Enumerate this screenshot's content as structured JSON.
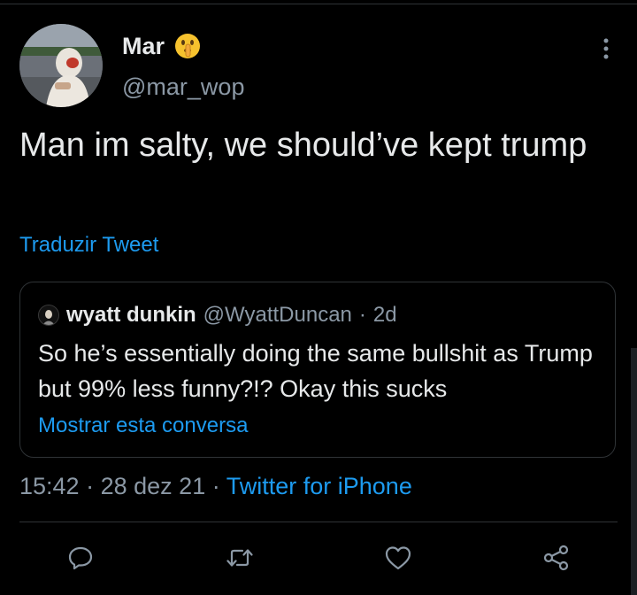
{
  "tweet": {
    "author_name": "Mar",
    "author_emoji": "shushing-face-emoji",
    "author_handle": "@mar_wop",
    "text": "Man im salty, we should’ve kept trump",
    "translate_label": "Traduzir Tweet"
  },
  "quoted": {
    "name": "wyatt dunkin",
    "handle": "@WyattDuncan",
    "separator": "·",
    "age": "2d",
    "text": "So he’s essentially doing the same bullshit as Trump but 99% less funny?!? Okay this sucks",
    "show_conversation": "Mostrar esta conversa"
  },
  "meta": {
    "time": "15:42",
    "sep1": "·",
    "date": "28 dez 21",
    "sep2": "·",
    "source": "Twitter for iPhone"
  },
  "icons": {
    "more": "more-vertical-icon",
    "reply": "reply-icon",
    "retweet": "retweet-icon",
    "like": "heart-icon",
    "share": "share-icon"
  },
  "colors": {
    "background": "#000000",
    "text": "#e7e9ea",
    "secondary": "#8b98a5",
    "link": "#1d9bf0",
    "border": "#2f3336"
  }
}
